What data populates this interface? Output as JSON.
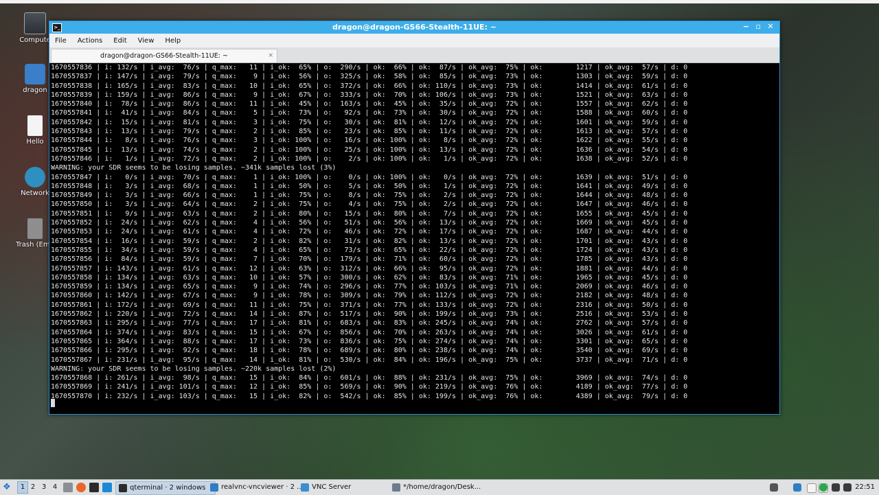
{
  "desktop": {
    "icons": [
      {
        "label": "Compute",
        "icon": "computer-icon"
      },
      {
        "label": "dragon",
        "icon": "home-folder-icon"
      },
      {
        "label": "Hello",
        "icon": "text-file-icon"
      },
      {
        "label": "Network",
        "icon": "network-icon"
      },
      {
        "label": "Trash (Emp",
        "icon": "trash-icon"
      }
    ]
  },
  "window": {
    "title": "dragon@dragon-GS66-Stealth-11UE: ~",
    "controls": {
      "minimize": "−",
      "maximize": "▫",
      "close": "✕"
    },
    "menu": [
      "File",
      "Actions",
      "Edit",
      "View",
      "Help"
    ],
    "tab": {
      "label": "dragon@dragon-GS66-Stealth-11UE: ~",
      "close": "×"
    }
  },
  "terminal": {
    "lines": [
      "1670557836 | i: 132/s | i_avg:  76/s | q_max:   11 | i_ok:  65% | o:  290/s | ok:  66% | ok:  87/s | ok_avg:  75% | ok:        1217 | ok_avg:  57/s | d: 0",
      "1670557837 | i: 147/s | i_avg:  79/s | q_max:    9 | i_ok:  56% | o:  325/s | ok:  58% | ok:  85/s | ok_avg:  73% | ok:        1303 | ok_avg:  59/s | d: 0",
      "1670557838 | i: 165/s | i_avg:  83/s | q_max:   10 | i_ok:  65% | o:  372/s | ok:  66% | ok: 110/s | ok_avg:  73% | ok:        1414 | ok_avg:  61/s | d: 0",
      "1670557839 | i: 159/s | i_avg:  86/s | q_max:    9 | i_ok:  67% | o:  333/s | ok:  70% | ok: 106/s | ok_avg:  73% | ok:        1521 | ok_avg:  63/s | d: 0",
      "1670557840 | i:  78/s | i_avg:  86/s | q_max:   11 | i_ok:  45% | o:  163/s | ok:  45% | ok:  35/s | ok_avg:  72% | ok:        1557 | ok_avg:  62/s | d: 0",
      "1670557841 | i:  41/s | i_avg:  84/s | q_max:    5 | i_ok:  73% | o:   92/s | ok:  73% | ok:  30/s | ok_avg:  72% | ok:        1588 | ok_avg:  60/s | d: 0",
      "1670557842 | i:  15/s | i_avg:  81/s | q_max:    3 | i_ok:  75% | o:   30/s | ok:  81% | ok:  12/s | ok_avg:  72% | ok:        1601 | ok_avg:  59/s | d: 0",
      "1670557843 | i:  13/s | i_avg:  79/s | q_max:    2 | i_ok:  85% | o:   23/s | ok:  85% | ok:  11/s | ok_avg:  72% | ok:        1613 | ok_avg:  57/s | d: 0",
      "1670557844 | i:   8/s | i_avg:  76/s | q_max:    3 | i_ok: 100% | o:   16/s | ok: 100% | ok:   8/s | ok_avg:  72% | ok:        1622 | ok_avg:  55/s | d: 0",
      "1670557845 | i:  13/s | i_avg:  74/s | q_max:    2 | i_ok: 100% | o:   25/s | ok: 100% | ok:  13/s | ok_avg:  72% | ok:        1636 | ok_avg:  54/s | d: 0",
      "1670557846 | i:   1/s | i_avg:  72/s | q_max:    2 | i_ok: 100% | o:    2/s | ok: 100% | ok:   1/s | ok_avg:  72% | ok:        1638 | ok_avg:  52/s | d: 0",
      "WARNING: your SDR seems to be losing samples. ~341k samples lost (3%)",
      "1670557847 | i:   0/s | i_avg:  70/s | q_max:    1 | i_ok: 100% | o:    0/s | ok: 100% | ok:   0/s | ok_avg:  72% | ok:        1639 | ok_avg:  51/s | d: 0",
      "1670557848 | i:   3/s | i_avg:  68/s | q_max:    1 | i_ok:  50% | o:    5/s | ok:  50% | ok:   1/s | ok_avg:  72% | ok:        1641 | ok_avg:  49/s | d: 0",
      "1670557849 | i:   3/s | i_avg:  66/s | q_max:    1 | i_ok:  75% | o:    8/s | ok:  75% | ok:   2/s | ok_avg:  72% | ok:        1644 | ok_avg:  48/s | d: 0",
      "1670557850 | i:   3/s | i_avg:  64/s | q_max:    2 | i_ok:  75% | o:    4/s | ok:  75% | ok:   2/s | ok_avg:  72% | ok:        1647 | ok_avg:  46/s | d: 0",
      "1670557851 | i:   9/s | i_avg:  63/s | q_max:    2 | i_ok:  80% | o:   15/s | ok:  80% | ok:   7/s | ok_avg:  72% | ok:        1655 | ok_avg:  45/s | d: 0",
      "1670557852 | i:  24/s | i_avg:  62/s | q_max:    4 | i_ok:  56% | o:   51/s | ok:  56% | ok:  13/s | ok_avg:  72% | ok:        1669 | ok_avg:  45/s | d: 0",
      "1670557853 | i:  24/s | i_avg:  61/s | q_max:    4 | i_ok:  72% | o:   46/s | ok:  72% | ok:  17/s | ok_avg:  72% | ok:        1687 | ok_avg:  44/s | d: 0",
      "1670557854 | i:  16/s | i_avg:  59/s | q_max:    2 | i_ok:  82% | o:   31/s | ok:  82% | ok:  13/s | ok_avg:  72% | ok:        1701 | ok_avg:  43/s | d: 0",
      "1670557855 | i:  34/s | i_avg:  59/s | q_max:    4 | i_ok:  65% | o:   73/s | ok:  65% | ok:  22/s | ok_avg:  72% | ok:        1724 | ok_avg:  43/s | d: 0",
      "1670557856 | i:  84/s | i_avg:  59/s | q_max:    7 | i_ok:  70% | o:  179/s | ok:  71% | ok:  60/s | ok_avg:  72% | ok:        1785 | ok_avg:  43/s | d: 0",
      "1670557857 | i: 143/s | i_avg:  61/s | q_max:   12 | i_ok:  63% | o:  312/s | ok:  66% | ok:  95/s | ok_avg:  72% | ok:        1881 | ok_avg:  44/s | d: 0",
      "1670557858 | i: 134/s | i_avg:  63/s | q_max:   10 | i_ok:  57% | o:  300/s | ok:  62% | ok:  83/s | ok_avg:  71% | ok:        1965 | ok_avg:  45/s | d: 0",
      "1670557859 | i: 134/s | i_avg:  65/s | q_max:    9 | i_ok:  74% | o:  296/s | ok:  77% | ok: 103/s | ok_avg:  71% | ok:        2069 | ok_avg:  46/s | d: 0",
      "1670557860 | i: 142/s | i_avg:  67/s | q_max:    9 | i_ok:  78% | o:  309/s | ok:  79% | ok: 112/s | ok_avg:  72% | ok:        2182 | ok_avg:  48/s | d: 0",
      "1670557861 | i: 172/s | i_avg:  69/s | q_max:   11 | i_ok:  75% | o:  371/s | ok:  77% | ok: 133/s | ok_avg:  72% | ok:        2316 | ok_avg:  50/s | d: 0",
      "1670557862 | i: 220/s | i_avg:  72/s | q_max:   14 | i_ok:  87% | o:  517/s | ok:  90% | ok: 199/s | ok_avg:  73% | ok:        2516 | ok_avg:  53/s | d: 0",
      "1670557863 | i: 295/s | i_avg:  77/s | q_max:   17 | i_ok:  81% | o:  683/s | ok:  83% | ok: 245/s | ok_avg:  74% | ok:        2762 | ok_avg:  57/s | d: 0",
      "1670557864 | i: 374/s | i_avg:  83/s | q_max:   15 | i_ok:  67% | o:  856/s | ok:  70% | ok: 263/s | ok_avg:  74% | ok:        3026 | ok_avg:  61/s | d: 0",
      "1670557865 | i: 364/s | i_avg:  88/s | q_max:   17 | i_ok:  73% | o:  836/s | ok:  75% | ok: 274/s | ok_avg:  74% | ok:        3301 | ok_avg:  65/s | d: 0",
      "1670557866 | i: 295/s | i_avg:  92/s | q_max:   18 | i_ok:  78% | o:  689/s | ok:  80% | ok: 238/s | ok_avg:  74% | ok:        3540 | ok_avg:  69/s | d: 0",
      "1670557867 | i: 231/s | i_avg:  95/s | q_max:   14 | i_ok:  81% | o:  530/s | ok:  84% | ok: 196/s | ok_avg:  75% | ok:        3737 | ok_avg:  71/s | d: 0",
      "WARNING: your SDR seems to be losing samples. ~220k samples lost (2%)",
      "1670557868 | i: 261/s | i_avg:  98/s | q_max:   15 | i_ok:  84% | o:  601/s | ok:  88% | ok: 231/s | ok_avg:  75% | ok:        3969 | ok_avg:  74/s | d: 0",
      "1670557869 | i: 241/s | i_avg: 101/s | q_max:   12 | i_ok:  85% | o:  569/s | ok:  90% | ok: 219/s | ok_avg:  76% | ok:        4189 | ok_avg:  77/s | d: 0",
      "1670557870 | i: 232/s | i_avg: 103/s | q_max:   15 | i_ok:  82% | o:  542/s | ok:  85% | ok: 199/s | ok_avg:  76% | ok:        4389 | ok_avg:  79/s | d: 0"
    ]
  },
  "taskbar": {
    "menu_icon": "application-menu-icon",
    "workspaces": [
      "1",
      "2",
      "3",
      "4"
    ],
    "active_workspace": "1",
    "launchers": [
      "file-manager-icon",
      "firefox-icon",
      "terminal-icon",
      "show-desktop-icon"
    ],
    "tasks": [
      {
        "label": "qterminal · 2 windows",
        "icon": "terminal-icon",
        "active": true
      },
      {
        "label": "realvnc-vncviewer · 2 ...",
        "icon": "vnc-viewer-icon",
        "active": false
      },
      {
        "label": "VNC Server",
        "icon": "vnc-server-icon",
        "active": false
      },
      {
        "label": "*/home/dragon/Desk...",
        "icon": "text-editor-icon",
        "active": false
      }
    ],
    "tray_icons": [
      "volume-icon",
      "vnc-tray-icon",
      "notes-icon",
      "clipboard-icon",
      "network-status-icon",
      "keyboard-icon",
      "display-icon"
    ],
    "clock": "22:51"
  },
  "colors": {
    "titlebar": "#3daee9",
    "terminal_bg": "#000000",
    "terminal_fg": "#e8e8e8",
    "taskbar_bg": "#dfe1e3"
  }
}
